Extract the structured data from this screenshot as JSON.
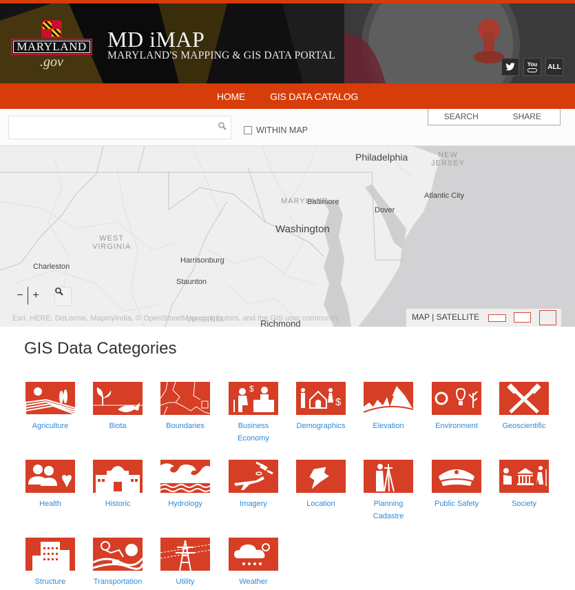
{
  "header": {
    "logo_text": "MARYLAND",
    "logo_sub": ".gov",
    "title": "MD iMAP",
    "subtitle": "MARYLAND'S MAPPING & GIS DATA PORTAL",
    "social": [
      {
        "name": "twitter-icon",
        "label": "🐦"
      },
      {
        "name": "youtube-icon",
        "label": "You"
      },
      {
        "name": "all-button",
        "label": "ALL"
      }
    ]
  },
  "nav": {
    "items": [
      "HOME",
      "GIS DATA CATALOG"
    ]
  },
  "search": {
    "value": "",
    "placeholder": "",
    "within_map_label": "WITHIN MAP",
    "tabs": [
      "SEARCH",
      "SHARE"
    ]
  },
  "map": {
    "cities": [
      {
        "name": "Philadelphia"
      },
      {
        "name": "Atlantic City"
      },
      {
        "name": "Baltimore"
      },
      {
        "name": "Dover"
      },
      {
        "name": "Washington"
      },
      {
        "name": "Charleston"
      },
      {
        "name": "Harrisonburg"
      },
      {
        "name": "Staunton"
      },
      {
        "name": "Richmond"
      }
    ],
    "states": [
      {
        "name": "NEW\nJERSEY"
      },
      {
        "name": "MARYLAND"
      },
      {
        "name": "WEST\nVIRGINIA"
      },
      {
        "name": "VIRGINIA"
      }
    ],
    "zoom_out": "−",
    "zoom_in": "+",
    "attribution": "Esri, HERE, DeLorme, MapmyIndia, © OpenStreetMap contributors, and the GIS user community",
    "basemap_label": "MAP | SATELLITE"
  },
  "categories": {
    "title": "GIS Data Categories",
    "accent_color": "#d63e25",
    "link_color": "#2e8ad8",
    "items": [
      {
        "label": "Agriculture",
        "icon": "agriculture-icon"
      },
      {
        "label": "Biota",
        "icon": "biota-icon"
      },
      {
        "label": "Boundaries",
        "icon": "boundaries-icon"
      },
      {
        "label": "Business\nEconomy",
        "icon": "business-economy-icon"
      },
      {
        "label": "Demographics",
        "icon": "demographics-icon"
      },
      {
        "label": "Elevation",
        "icon": "elevation-icon"
      },
      {
        "label": "Environment",
        "icon": "environment-icon"
      },
      {
        "label": "Geoscientific",
        "icon": "geoscientific-icon"
      },
      {
        "label": "Health",
        "icon": "health-icon"
      },
      {
        "label": "Historic",
        "icon": "historic-icon"
      },
      {
        "label": "Hydrology",
        "icon": "hydrology-icon"
      },
      {
        "label": "Imagery",
        "icon": "imagery-icon"
      },
      {
        "label": "Location",
        "icon": "location-icon"
      },
      {
        "label": "Planning\nCadastre",
        "icon": "planning-cadastre-icon"
      },
      {
        "label": "Public Safety",
        "icon": "public-safety-icon"
      },
      {
        "label": "Society",
        "icon": "society-icon"
      },
      {
        "label": "Structure",
        "icon": "structure-icon"
      },
      {
        "label": "Transportation",
        "icon": "transportation-icon"
      },
      {
        "label": "Utility",
        "icon": "utility-icon"
      },
      {
        "label": "Weather",
        "icon": "weather-icon"
      }
    ]
  }
}
